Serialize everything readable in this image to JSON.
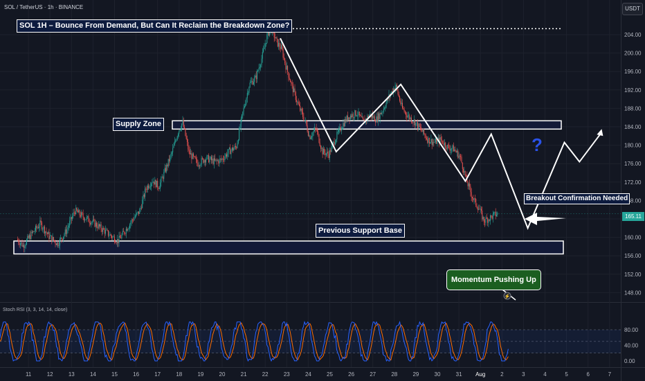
{
  "header": {
    "symbol_line": "SOL / TetherUS · 1h · BINANCE",
    "currency_badge": "USDT"
  },
  "annotations": {
    "title": "SOL 1H – Bounce From Demand, But Can It Reclaim the Breakdown Zone?",
    "supply_zone": "Supply Zone",
    "support_base": "Previous Support Base",
    "breakout": "Breakout Confirmation Needed",
    "momentum": "Momentum Pushing Up",
    "question": "?"
  },
  "current_price": {
    "value": 165.11,
    "label": "165.11"
  },
  "colors": {
    "background": "#131722",
    "up": "#26a69a",
    "down": "#ef5350",
    "grid": "#1e222d",
    "axis_text": "#b2b5be",
    "zone_fill": "#131a38",
    "price_badge": "#26a69a",
    "stoch_k": "#2962ff",
    "stoch_d": "#ff6d00",
    "momentum_box": "#1b5e20"
  },
  "chart_data": {
    "type": "candlestick",
    "price_axis": {
      "ticks": [
        "204.00",
        "200.00",
        "196.00",
        "192.00",
        "188.00",
        "184.00",
        "180.00",
        "176.00",
        "172.00",
        "168.00",
        "164.00",
        "160.00",
        "156.00",
        "152.00",
        "148.00"
      ],
      "ylim": [
        145.5,
        207.5
      ]
    },
    "time_axis": {
      "ticks": [
        "11",
        "12",
        "13",
        "14",
        "15",
        "16",
        "17",
        "18",
        "19",
        "20",
        "21",
        "22",
        "23",
        "24",
        "25",
        "26",
        "27",
        "28",
        "29",
        "30",
        "31",
        "Aug",
        "2",
        "3",
        "4",
        "5",
        "6",
        "7"
      ]
    },
    "price_path": [
      [
        10.5,
        159.6
      ],
      [
        10.8,
        158.2
      ],
      [
        11.2,
        160.8
      ],
      [
        11.6,
        163.0
      ],
      [
        12.0,
        160.2
      ],
      [
        12.4,
        158.6
      ],
      [
        12.8,
        161.4
      ],
      [
        13.2,
        165.8
      ],
      [
        13.6,
        164.4
      ],
      [
        14.0,
        163.4
      ],
      [
        14.4,
        162.0
      ],
      [
        14.8,
        160.6
      ],
      [
        15.2,
        159.2
      ],
      [
        15.5,
        161.2
      ],
      [
        15.9,
        164.0
      ],
      [
        16.2,
        165.6
      ],
      [
        16.5,
        170.6
      ],
      [
        16.8,
        172.4
      ],
      [
        17.1,
        171.0
      ],
      [
        17.4,
        174.6
      ],
      [
        17.7,
        178.2
      ],
      [
        18.0,
        183.0
      ],
      [
        18.2,
        185.0
      ],
      [
        18.5,
        178.4
      ],
      [
        18.9,
        176.0
      ],
      [
        19.3,
        177.2
      ],
      [
        19.7,
        176.4
      ],
      [
        20.0,
        176.8
      ],
      [
        20.4,
        178.8
      ],
      [
        20.7,
        179.6
      ],
      [
        21.0,
        187.0
      ],
      [
        21.3,
        193.2
      ],
      [
        21.6,
        194.6
      ],
      [
        21.9,
        199.2
      ],
      [
        22.1,
        203.2
      ],
      [
        22.3,
        205.6
      ],
      [
        22.6,
        202.2
      ],
      [
        22.8,
        201.0
      ],
      [
        23.0,
        197.2
      ],
      [
        23.3,
        192.6
      ],
      [
        23.6,
        188.4
      ],
      [
        23.9,
        185.2
      ],
      [
        24.1,
        181.8
      ],
      [
        24.4,
        183.6
      ],
      [
        24.7,
        178.6
      ],
      [
        25.0,
        178.0
      ],
      [
        25.3,
        181.4
      ],
      [
        25.6,
        184.2
      ],
      [
        25.9,
        186.2
      ],
      [
        26.3,
        187.0
      ],
      [
        26.6,
        185.0
      ],
      [
        26.9,
        186.6
      ],
      [
        27.2,
        185.6
      ],
      [
        27.5,
        187.6
      ],
      [
        27.8,
        190.6
      ],
      [
        28.1,
        193.0
      ],
      [
        28.4,
        188.0
      ],
      [
        28.7,
        186.2
      ],
      [
        29.0,
        185.0
      ],
      [
        29.3,
        183.2
      ],
      [
        29.6,
        181.2
      ],
      [
        29.9,
        180.6
      ],
      [
        30.2,
        181.2
      ],
      [
        30.5,
        179.6
      ],
      [
        30.8,
        179.2
      ],
      [
        31.1,
        177.4
      ],
      [
        31.4,
        172.2
      ],
      [
        31.7,
        168.4
      ],
      [
        32.0,
        166.0
      ],
      [
        32.2,
        163.6
      ],
      [
        32.4,
        164.0
      ],
      [
        32.6,
        164.6
      ],
      [
        32.8,
        165.1
      ]
    ],
    "projection_path": [
      [
        22.7,
        203.2
      ],
      [
        25.3,
        178.6
      ],
      [
        28.3,
        193.2
      ],
      [
        31.3,
        172.2
      ],
      [
        32.5,
        182.4
      ],
      [
        34.2,
        162.0
      ],
      [
        35.9,
        180.6
      ],
      [
        36.6,
        176.4
      ],
      [
        37.6,
        182.6
      ]
    ],
    "zones": [
      {
        "name": "Supply Zone",
        "top": 185.3,
        "bottom": 183.5
      },
      {
        "name": "Previous Support Base",
        "top": 159.2,
        "bottom": 156.4
      }
    ],
    "dotted_top_level": 205.3,
    "stoch_rsi": {
      "label": "Stoch RSI (3, 3, 14, 14, close)",
      "ticks": [
        "80.00",
        "40.00",
        "0.00"
      ],
      "ylim": [
        -10,
        100
      ],
      "bands": [
        80,
        50,
        20
      ]
    }
  }
}
